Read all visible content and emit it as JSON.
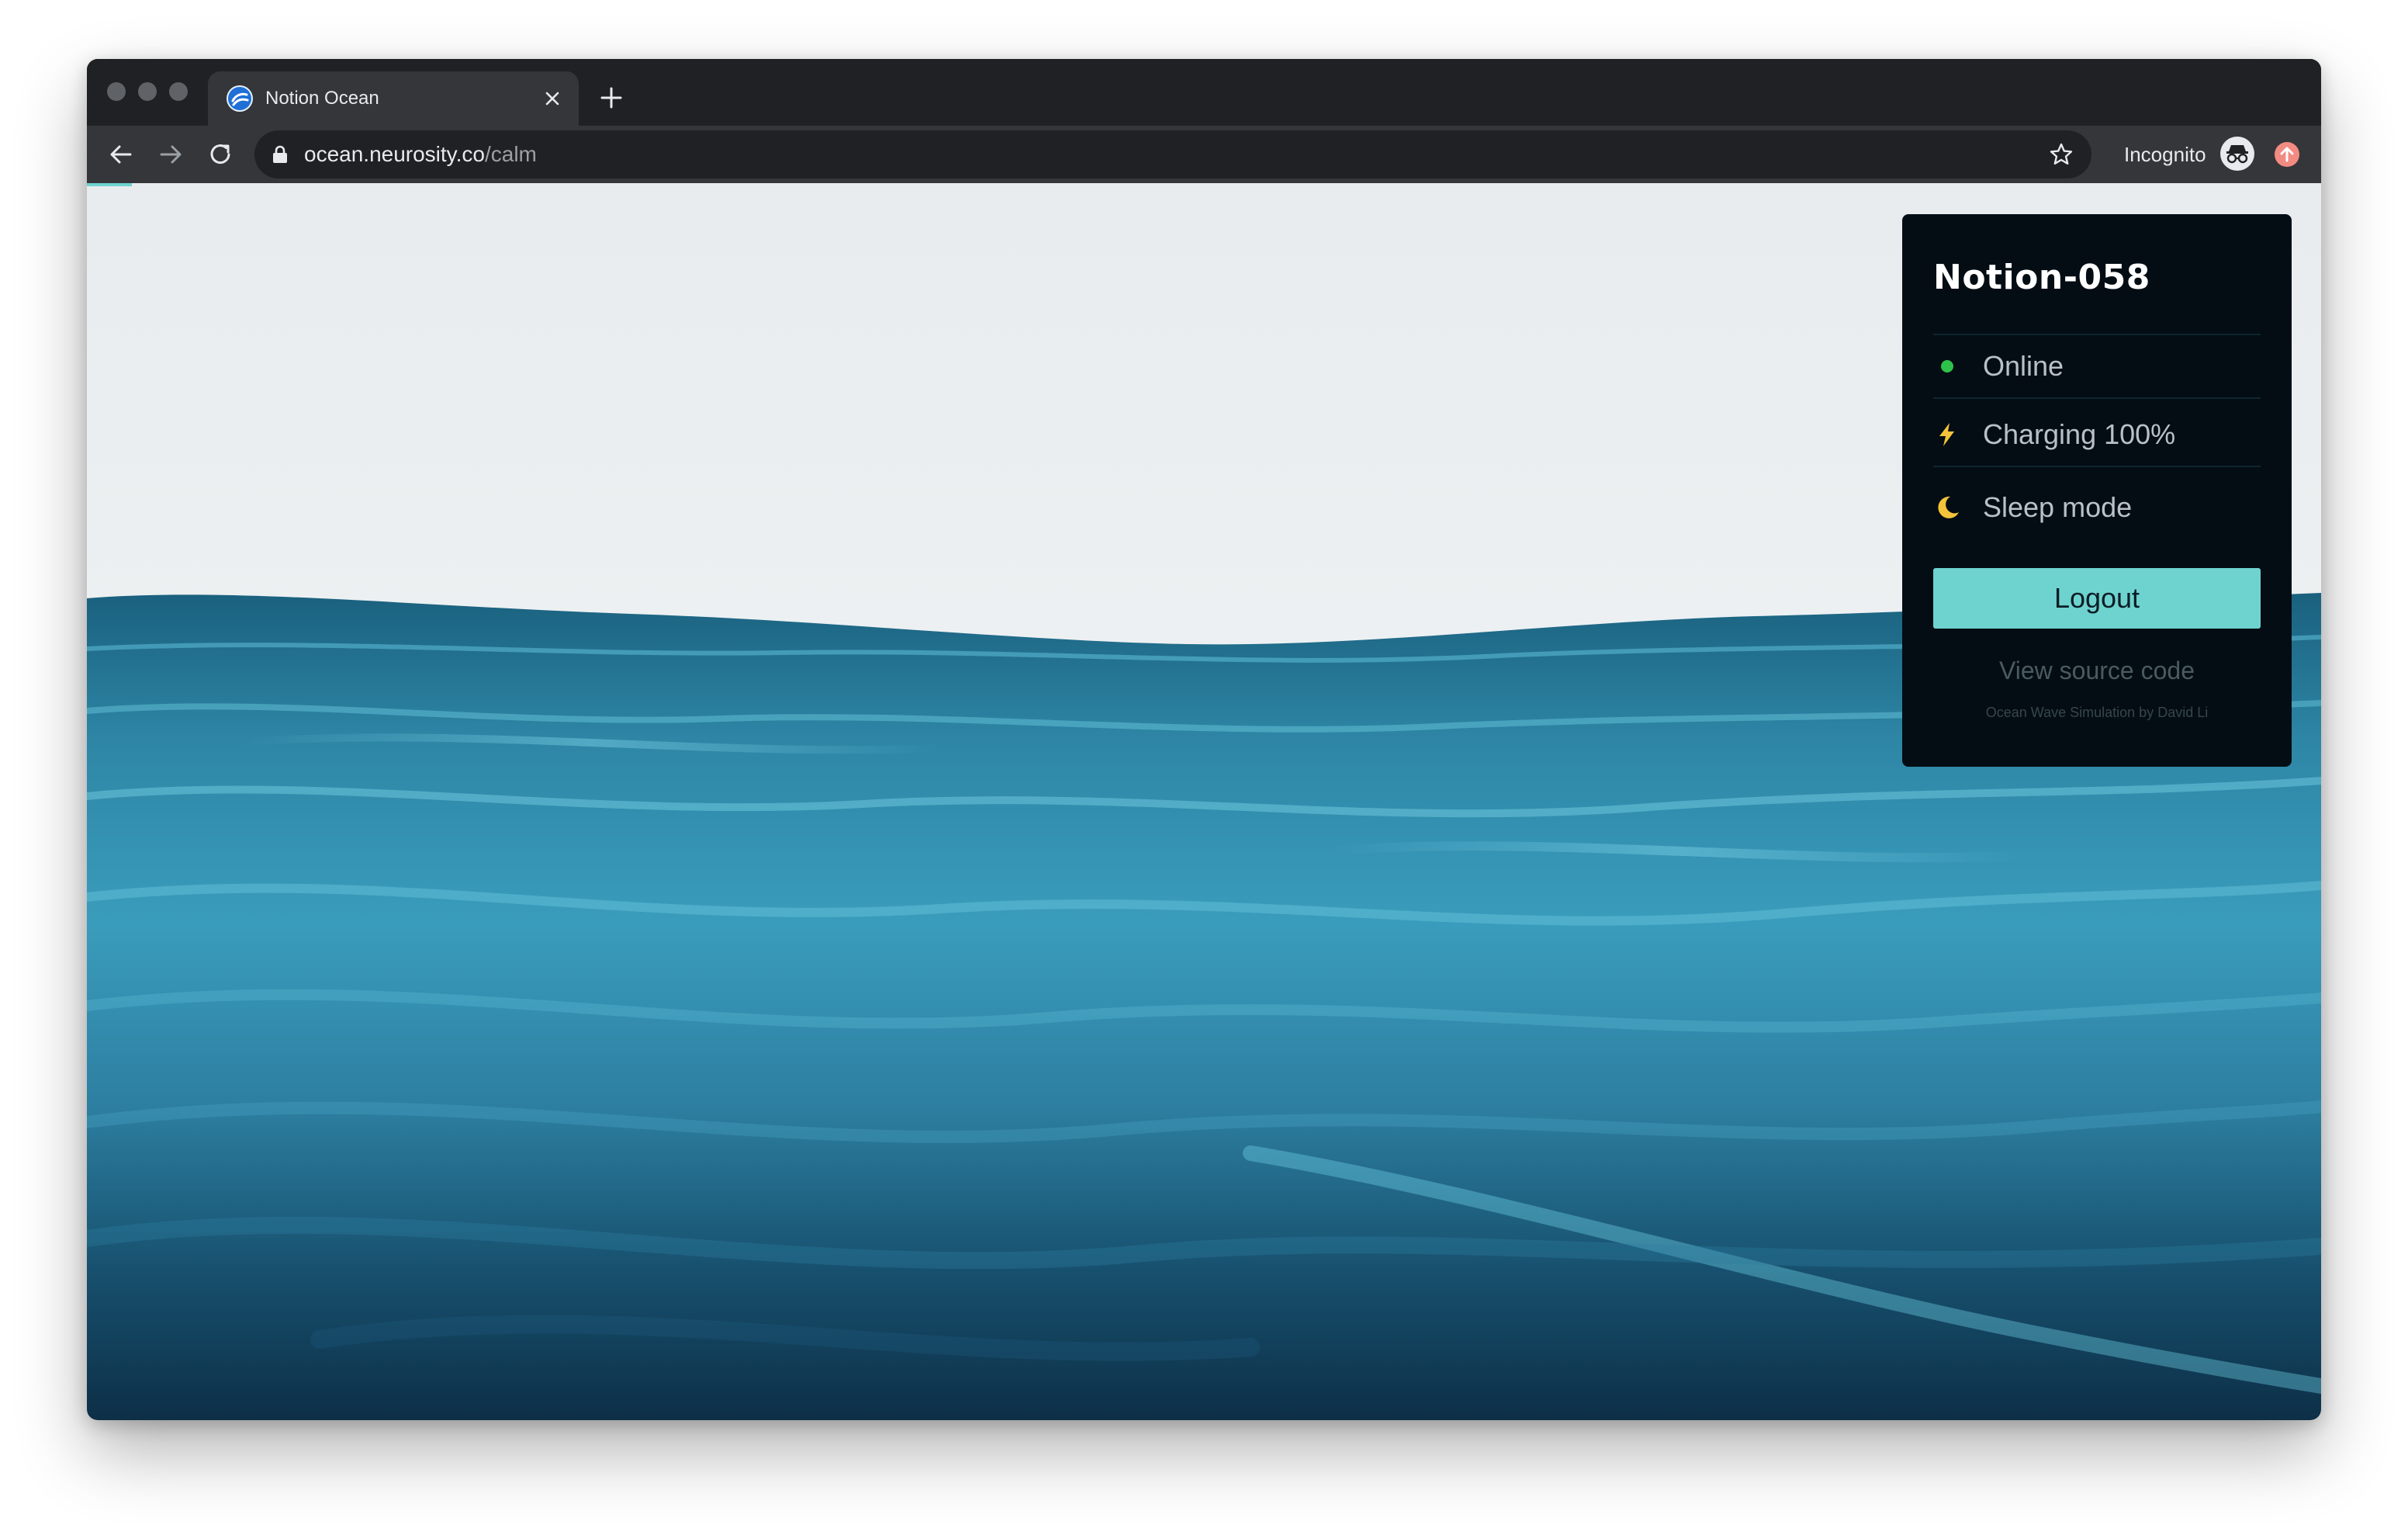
{
  "browser": {
    "tab": {
      "title": "Notion Ocean",
      "favicon": "neurosity-logo-icon"
    },
    "url": {
      "host": "ocean.neurosity.co",
      "path": "/calm"
    },
    "incognito_label": "Incognito"
  },
  "panel": {
    "device_name": "Notion-058",
    "statuses": [
      {
        "icon": "online-dot-icon",
        "label": "Online",
        "color": "#2ec24a"
      },
      {
        "icon": "lightning-bolt-icon",
        "label": "Charging 100%",
        "color": "#f5c33b"
      },
      {
        "icon": "crescent-moon-icon",
        "label": "Sleep mode",
        "color": "#f5c33b"
      }
    ],
    "logout_label": "Logout",
    "source_link": "View source code",
    "credit": "Ocean Wave Simulation by David Li"
  },
  "colors": {
    "accent": "#6ed3cf",
    "panel_bg": "#040d14",
    "sky": "#eef1f3",
    "ocean_deep": "#0f3a55",
    "ocean_light": "#4fb2cf"
  }
}
